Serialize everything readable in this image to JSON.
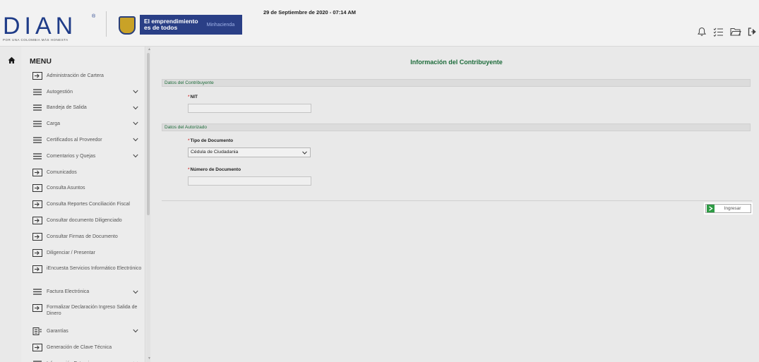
{
  "header": {
    "logo_text": "DIAN",
    "logo_tagline": "POR UNA COLOMBIA MÁS HONESTA",
    "gov_banner_line1": "El emprendimiento",
    "gov_banner_line2": "es de todos",
    "gov_banner_sub": "Minhacienda",
    "datetime": "29 de Septiembre de 2020 - 07:14 AM",
    "icons": [
      "bell-icon",
      "checklist-icon",
      "folder-icon",
      "logout-icon"
    ]
  },
  "sidebar": {
    "title": "MENU",
    "items": [
      {
        "label": "Administración de Cartera",
        "icon": "enter-icon",
        "expandable": false
      },
      {
        "label": "Autogestión",
        "icon": "list-icon",
        "expandable": true
      },
      {
        "label": "Bandeja de Salida",
        "icon": "list-icon",
        "expandable": true
      },
      {
        "label": "Carga",
        "icon": "list-icon",
        "expandable": true
      },
      {
        "label": "Certificados al Proveedor",
        "icon": "list-icon",
        "expandable": true
      },
      {
        "label": "Comentarios y Quejas",
        "icon": "list-icon",
        "expandable": true
      },
      {
        "label": "Comunicados",
        "icon": "enter-icon",
        "expandable": false
      },
      {
        "label": "Consulta Asuntos",
        "icon": "enter-icon",
        "expandable": false
      },
      {
        "label": "Consulta Reportes Conciliación Fiscal",
        "icon": "enter-icon",
        "expandable": false
      },
      {
        "label": "Consultar documento Diligenciado",
        "icon": "enter-icon",
        "expandable": false
      },
      {
        "label": "Consultar Firmas de Documento",
        "icon": "enter-icon",
        "expandable": false
      },
      {
        "label": "Diligenciar / Presentar",
        "icon": "enter-icon",
        "expandable": false
      },
      {
        "label": "iEncuesta Servicios Informático Electrónico",
        "icon": "enter-icon",
        "expandable": false
      },
      {
        "label": "Factura Electrónica",
        "icon": "list-icon",
        "expandable": true
      },
      {
        "label": "Formalizar Declaración Ingreso Salida de Dinero",
        "icon": "enter-icon",
        "expandable": false
      },
      {
        "label": "Garantías",
        "icon": "doc-icon",
        "expandable": true
      },
      {
        "label": "Generación de Clave Técnica",
        "icon": "enter-icon",
        "expandable": false
      },
      {
        "label": "Información Extranjera",
        "icon": "list-icon",
        "expandable": true
      }
    ]
  },
  "main": {
    "title": "Información del Contribuyente",
    "section_contribuyente": "Datos del Contribuyente",
    "nit_label": "NIT",
    "nit_value": "",
    "section_autorizado": "Datos del Autorizado",
    "tipo_doc_label": "Tipo de Documento",
    "tipo_doc_value": "Cédula de Ciudadania",
    "num_doc_label": "Número de Documento",
    "num_doc_value": "",
    "required_mark": "*",
    "submit_label": "Ingresar"
  },
  "colors": {
    "accent_green": "#2e9b45",
    "title_green": "#1d6b3a",
    "brand_blue": "#1f3c88"
  }
}
